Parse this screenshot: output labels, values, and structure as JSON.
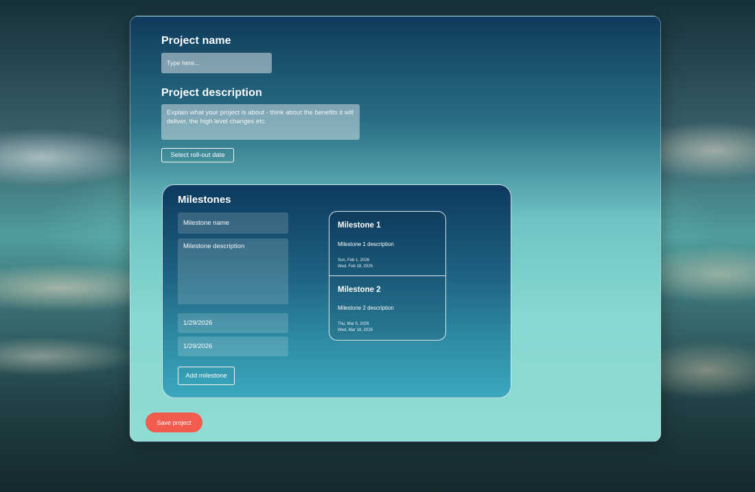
{
  "form": {
    "project_name_label": "Project name",
    "project_name_placeholder": "Type here...",
    "project_description_label": "Project description",
    "project_description_placeholder": "Explain what your project is about - think about the benefits it will deliver, the high level changes etc.",
    "rollout_button": "Select roll-out date",
    "save_button": "Save project"
  },
  "milestones": {
    "title": "Milestones",
    "name_placeholder": "Milestone name",
    "description_placeholder": "Milestone description",
    "start_date_value": "1/29/2026",
    "end_date_value": "1/29/2026",
    "add_button": "Add milestone",
    "items": [
      {
        "title": "Milestone 1",
        "description": "Milestone 1 description",
        "start": "Sun, Feb 1, 2026",
        "end": "Wed, Feb 18, 2026"
      },
      {
        "title": "Milestone 2",
        "description": "Milestone 2 description",
        "start": "Thu, Mar 5, 2026",
        "end": "Wed, Mar 18, 2026"
      }
    ]
  },
  "colors": {
    "accent": "#f25c4f",
    "card_top": "#0e3a5c",
    "card_bottom": "#8fdcd3"
  }
}
